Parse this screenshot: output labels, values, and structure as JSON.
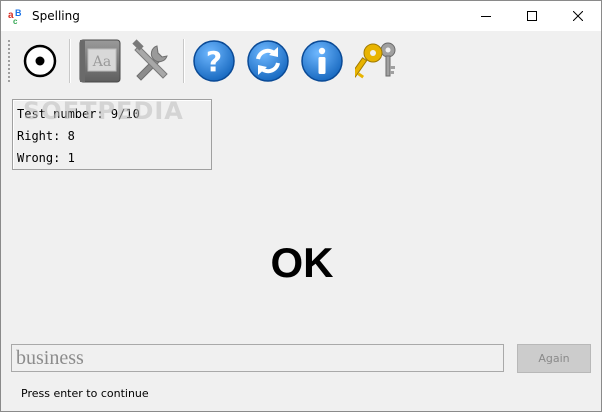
{
  "window": {
    "title": "Spelling"
  },
  "toolbar": {
    "items": [
      {
        "icon": "stop-circle-icon"
      },
      {
        "icon": "dictionary-book-icon"
      },
      {
        "icon": "tools-settings-icon"
      },
      {
        "icon": "help-question-icon"
      },
      {
        "icon": "refresh-icon"
      },
      {
        "icon": "info-icon"
      },
      {
        "icon": "keys-icon"
      }
    ]
  },
  "stats": {
    "test_number": "Test number: 9/10",
    "right": "Right: 8",
    "wrong": "Wrong: 1"
  },
  "watermark": "SOFTPEDIA",
  "result": {
    "text": "OK"
  },
  "answer": {
    "value": "business"
  },
  "again_button": {
    "label": "Again"
  },
  "status_bar": {
    "text": "Press enter to continue"
  },
  "colors": {
    "help_blue": "#1e7fd6",
    "key_gold": "#e8b400",
    "tools_gray": "#8c8c8c"
  }
}
